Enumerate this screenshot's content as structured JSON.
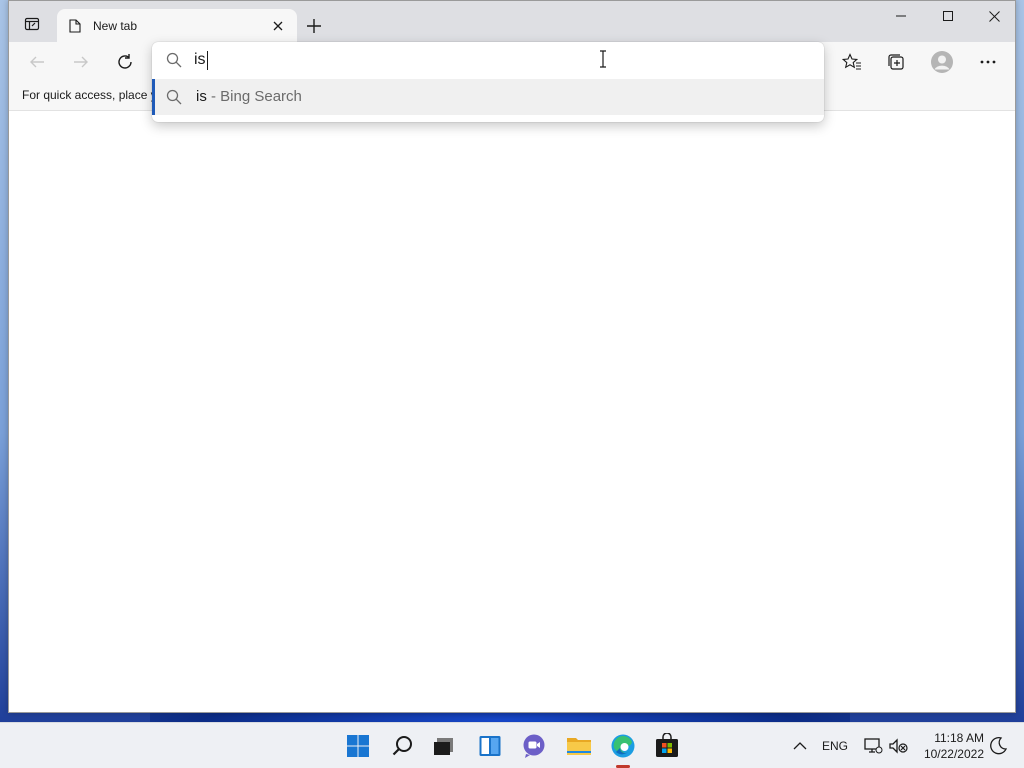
{
  "browser": {
    "tab": {
      "title": "New tab"
    },
    "favorites_bar": {
      "message": "For quick access, place y"
    }
  },
  "omnibox": {
    "value": "is",
    "suggestions": [
      {
        "query": "is",
        "source": " - Bing Search"
      }
    ]
  },
  "taskbar": {
    "apps": [
      "start-icon",
      "search-icon",
      "task-view-icon",
      "widgets-icon",
      "chat-icon",
      "file-explorer-icon",
      "edge-icon",
      "store-icon"
    ],
    "tray": {
      "language": "ENG",
      "time": "11:18 AM",
      "date": "10/22/2022"
    }
  },
  "colors": {
    "accent": "#1f5ab8",
    "active_app_indicator": "#c0392b"
  }
}
